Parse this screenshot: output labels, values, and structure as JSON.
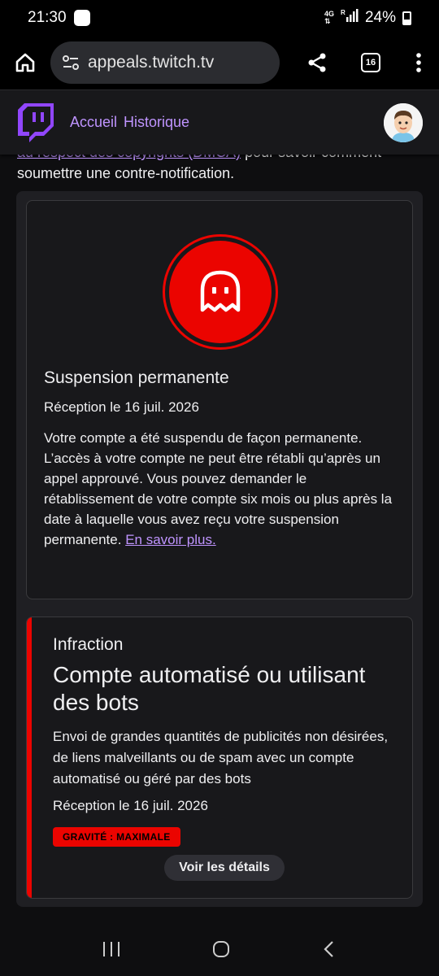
{
  "status_bar": {
    "time": "21:30",
    "network_top": "4G",
    "network_bottom": "⇅",
    "roaming": "R",
    "battery": "24%"
  },
  "browser": {
    "url": "appeals.twitch.tv",
    "tab_count": "16"
  },
  "site_nav": {
    "links": [
      "Accueil",
      "Historique"
    ],
    "brand_color": "#9146ff"
  },
  "intro": {
    "link_text": "au respect des copyrights (DMCA)",
    "text_after_link": " pour savoir comment",
    "line2": "soumettre une contre-notification."
  },
  "suspension": {
    "icon": "ghost-icon",
    "title": "Suspension permanente",
    "date": "Réception le 16 juil. 2026",
    "body": "Votre compte a été suspendu de façon permanente. L’accès à votre compte ne peut être rétabli qu’après un appel approuvé. Vous pouvez demander le rétablissement de votre compte six mois ou plus après la date à laquelle vous avez reçu votre suspension permanente. ",
    "learn_more": "En savoir plus."
  },
  "infraction": {
    "kicker": "Infraction",
    "title": "Compte automatisé ou utilisant des bots",
    "description": "Envoi de grandes quantités de publicités non désirées, de liens malveillants ou de spam avec un compte automatisé ou géré par des bots",
    "date": "Réception le 16 juil. 2026",
    "severity": "GRAVITÉ : MAXIMALE",
    "details_button": "Voir les détails",
    "accent_color": "#eb0400"
  }
}
